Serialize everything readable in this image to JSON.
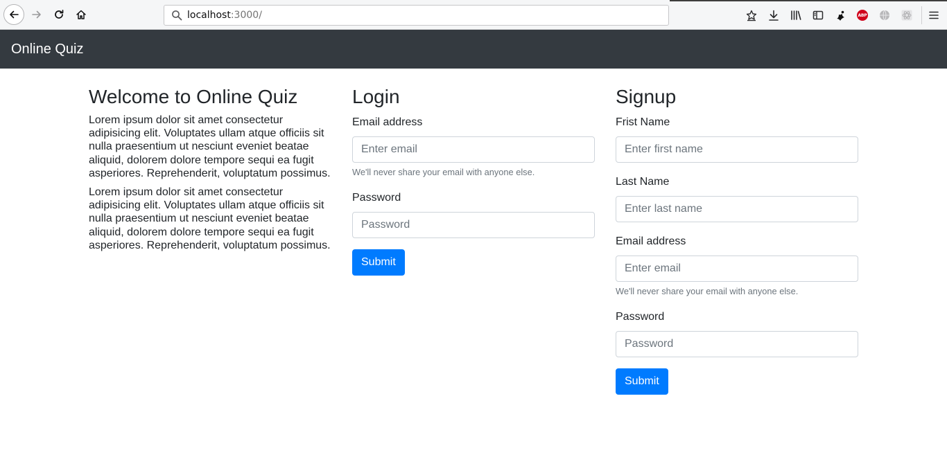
{
  "browser": {
    "url_host": "localhost",
    "url_port_path": ":3000/",
    "toolbar_icons": [
      "back-icon",
      "forward-icon",
      "reload-icon",
      "home-icon",
      "bookmark-star-icon",
      "download-icon",
      "library-icon",
      "sidebar-icon",
      "extension-icon",
      "adblock-icon",
      "globe-icon",
      "atom-icon",
      "menu-icon"
    ],
    "adblock_label": "ABP"
  },
  "navbar": {
    "brand": "Online Quiz",
    "background": "#343a40"
  },
  "welcome": {
    "title": "Welcome to Online Quiz",
    "paragraphs": [
      "Lorem ipsum dolor sit amet consectetur adipisicing elit. Voluptates ullam atque officiis sit nulla praesentium ut nesciunt eveniet beatae aliquid, dolorem dolore tempore sequi ea fugit asperiores. Reprehenderit, voluptatum possimus.",
      "Lorem ipsum dolor sit amet consectetur adipisicing elit. Voluptates ullam atque officiis sit nulla praesentium ut nesciunt eveniet beatae aliquid, dolorem dolore tempore sequi ea fugit asperiores. Reprehenderit, voluptatum possimus."
    ]
  },
  "login": {
    "title": "Login",
    "email_label": "Email address",
    "email_placeholder": "Enter email",
    "email_help": "We'll never share your email with anyone else.",
    "password_label": "Password",
    "password_placeholder": "Password",
    "submit_label": "Submit"
  },
  "signup": {
    "title": "Signup",
    "first_name_label": "Frist Name",
    "first_name_placeholder": "Enter first name",
    "last_name_label": "Last Name",
    "last_name_placeholder": "Enter last name",
    "email_label": "Email address",
    "email_placeholder": "Enter email",
    "email_help": "We'll never share your email with anyone else.",
    "password_label": "Password",
    "password_placeholder": "Password",
    "submit_label": "Submit"
  },
  "colors": {
    "primary": "#007bff",
    "text": "#212529",
    "muted": "#6c757d"
  }
}
